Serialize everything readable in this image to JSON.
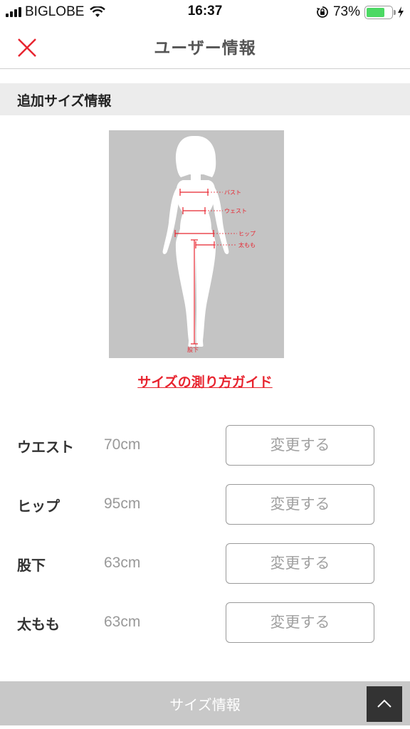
{
  "status_bar": {
    "carrier": "BIGLOBE",
    "time": "16:37",
    "battery_percent": "73%",
    "battery_level": 0.73,
    "icons": [
      "signal-icon",
      "wifi-icon",
      "rotation-lock-icon",
      "battery-icon",
      "charging-icon"
    ]
  },
  "nav": {
    "title": "ユーザー情報",
    "close_icon": "close-icon"
  },
  "section": {
    "title": "追加サイズ情報"
  },
  "figure": {
    "labels": {
      "bust": "バスト",
      "waist": "ウェスト",
      "hip": "ヒップ",
      "thigh": "太もも",
      "inseam": "股下"
    }
  },
  "guide_link": "サイズの測り方ガイド",
  "sizes": [
    {
      "label": "ウエスト",
      "value": "70cm",
      "button": "変更する"
    },
    {
      "label": "ヒップ",
      "value": "95cm",
      "button": "変更する"
    },
    {
      "label": "股下",
      "value": "63cm",
      "button": "変更する"
    },
    {
      "label": "太もも",
      "value": "63cm",
      "button": "変更する"
    }
  ],
  "bottom_bar": {
    "label": "サイズ情報",
    "scroll_top_icon": "chevron-up-icon"
  },
  "colors": {
    "accent_red": "#e8242f",
    "battery_green": "#4cd964",
    "bottom_bar": "#c8c8c8"
  }
}
